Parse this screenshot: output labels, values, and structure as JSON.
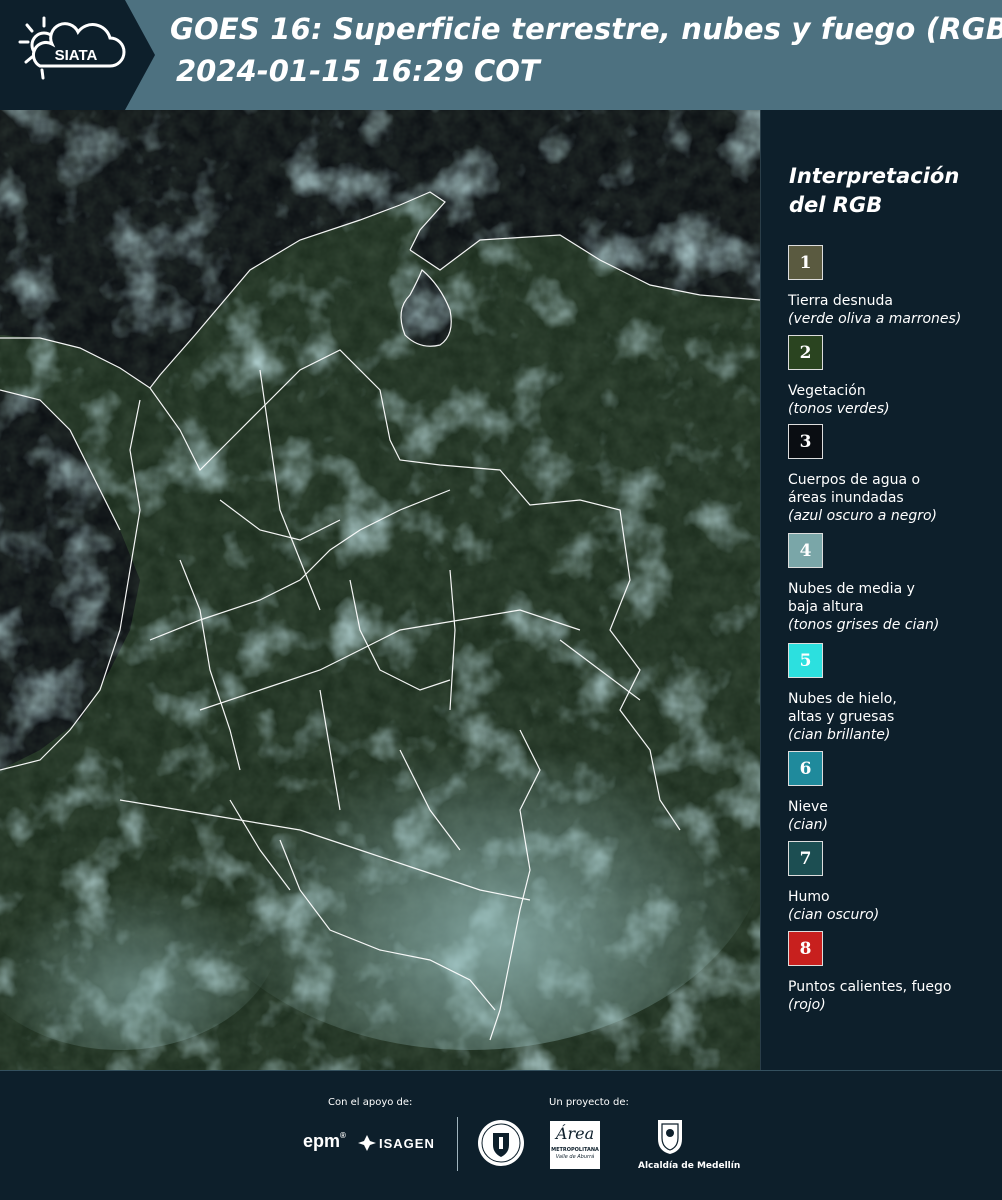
{
  "header": {
    "logo_text": "SIATA",
    "title_line1": "GOES 16: Superficie terrestre, nubes y fuego (RGB)",
    "title_line2": "2024-01-15 16:29 COT"
  },
  "legend": {
    "title": "Interpretación del RGB",
    "items": [
      {
        "number": "1",
        "label": "Tierra desnuda",
        "note": "(verde oliva a marrones)",
        "color": "#5a5a40"
      },
      {
        "number": "2",
        "label": "Vegetación",
        "note": "(tonos verdes)",
        "color": "#2a4420"
      },
      {
        "number": "3",
        "label": "Cuerpos de agua o áreas inundadas",
        "note": "(azul oscuro a negro)",
        "color": "#0a0d12"
      },
      {
        "number": "4",
        "label": "Nubes de media y baja altura",
        "note": "(tonos grises de cian)",
        "color": "#7aa6a8"
      },
      {
        "number": "5",
        "label": "Nubes de hielo, altas y gruesas",
        "note": "(cian brillante)",
        "color": "#2ce0df"
      },
      {
        "number": "6",
        "label": "Nieve",
        "note": "(cian)",
        "color": "#1f8a9c"
      },
      {
        "number": "7",
        "label": "Humo",
        "note": "(cian oscuro)",
        "color": "#1c4e52"
      },
      {
        "number": "8",
        "label": "Puntos calientes, fuego",
        "note": "(rojo)",
        "color": "#c8201e"
      }
    ]
  },
  "footer": {
    "support_caption": "Con el apoyo de:",
    "project_caption": "Un proyecto de:",
    "sponsor_epm": "epm",
    "sponsor_isagen": "ISAGEN",
    "sponsor_area": "Área",
    "sponsor_area_sub": "METROPOLITANA",
    "sponsor_area_sub2": "Valle de Aburrá",
    "sponsor_medellin": "Alcaldía de Medellín"
  }
}
